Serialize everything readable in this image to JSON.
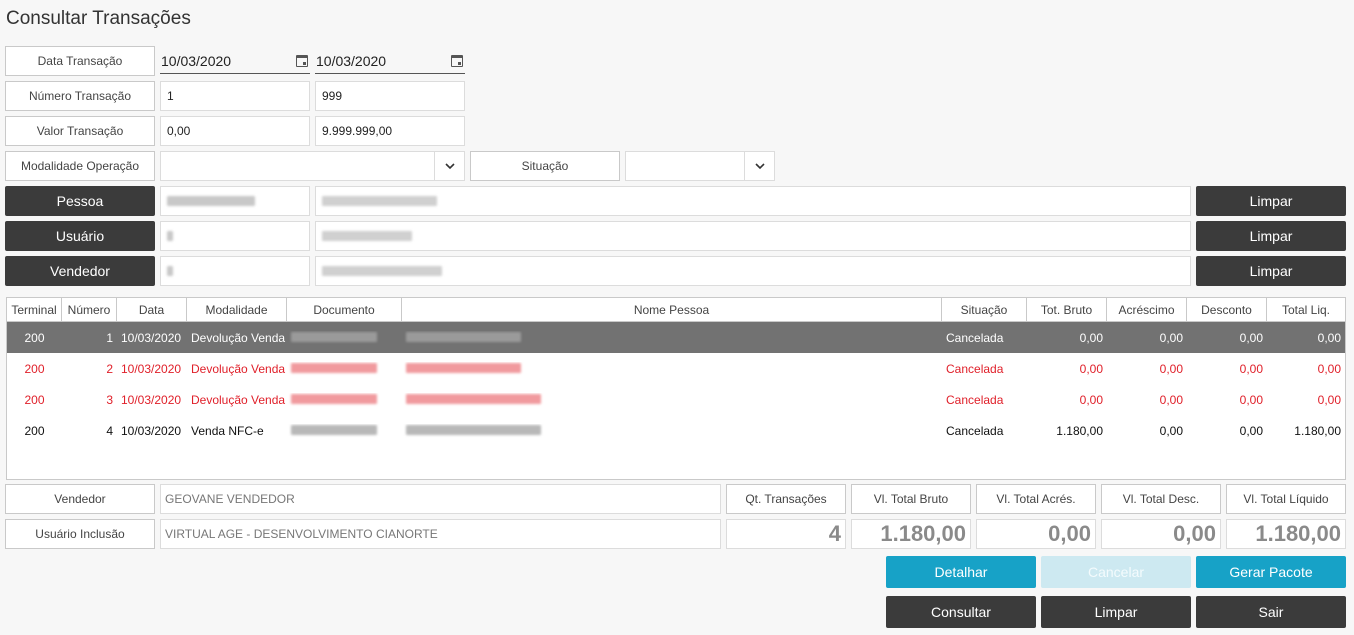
{
  "title": "Consultar Transações",
  "filters": {
    "data_label": "Data Transação",
    "data_from": "10/03/2020",
    "data_to": "10/03/2020",
    "numero_label": "Número Transação",
    "numero_from": "1",
    "numero_to": "999",
    "valor_label": "Valor Transação",
    "valor_from": "0,00",
    "valor_to": "9.999.999,00",
    "modalidade_label": "Modalidade Operação",
    "modalidade_value": "",
    "situacao_label": "Situação",
    "situacao_value": ""
  },
  "people": {
    "pessoa_button": "Pessoa",
    "usuario_button": "Usuário",
    "vendedor_button": "Vendedor",
    "limpar_label": "Limpar"
  },
  "grid": {
    "headers": [
      "Terminal",
      "Número",
      "Data",
      "Modalidade",
      "Documento",
      "Nome Pessoa",
      "Situação",
      "Tot. Bruto",
      "Acréscimo",
      "Desconto",
      "Total Liq."
    ],
    "rows": [
      {
        "terminal": "200",
        "numero": "1",
        "data": "10/03/2020",
        "modalidade": "Devolução Venda",
        "situacao": "Cancelada",
        "bruto": "0,00",
        "acrescimo": "0,00",
        "desconto": "0,00",
        "liquido": "0,00"
      },
      {
        "terminal": "200",
        "numero": "2",
        "data": "10/03/2020",
        "modalidade": "Devolução Venda",
        "situacao": "Cancelada",
        "bruto": "0,00",
        "acrescimo": "0,00",
        "desconto": "0,00",
        "liquido": "0,00"
      },
      {
        "terminal": "200",
        "numero": "3",
        "data": "10/03/2020",
        "modalidade": "Devolução Venda",
        "situacao": "Cancelada",
        "bruto": "0,00",
        "acrescimo": "0,00",
        "desconto": "0,00",
        "liquido": "0,00"
      },
      {
        "terminal": "200",
        "numero": "4",
        "data": "10/03/2020",
        "modalidade": "Venda NFC-e",
        "situacao": "Cancelada",
        "bruto": "1.180,00",
        "acrescimo": "0,00",
        "desconto": "0,00",
        "liquido": "1.180,00"
      }
    ]
  },
  "details": {
    "vendedor_label": "Vendedor",
    "vendedor_value": "GEOVANE VENDEDOR",
    "usuario_label": "Usuário Inclusão",
    "usuario_value": "VIRTUAL AGE - DESENVOLVIMENTO CIANORTE"
  },
  "totals": {
    "qt_label": "Qt. Transações",
    "qt_value": "4",
    "bruto_label": "Vl. Total Bruto",
    "bruto_value": "1.180,00",
    "acres_label": "Vl. Total Acrés.",
    "acres_value": "0,00",
    "desc_label": "Vl. Total Desc.",
    "desc_value": "0,00",
    "liq_label": "Vl. Total Líquido",
    "liq_value": "1.180,00"
  },
  "actions": {
    "detalhar": "Detalhar",
    "cancelar": "Cancelar",
    "gerar_pacote": "Gerar Pacote",
    "consultar": "Consultar",
    "limpar": "Limpar",
    "sair": "Sair"
  },
  "colors": {
    "dark_button": "#3b3b3b",
    "teal_button": "#17a2c7",
    "disabled_button": "#cde9f1",
    "selected_row": "#727272",
    "cancel_red": "#e0202a"
  },
  "icons": [
    "calendar-icon",
    "chevron-down-icon"
  ]
}
